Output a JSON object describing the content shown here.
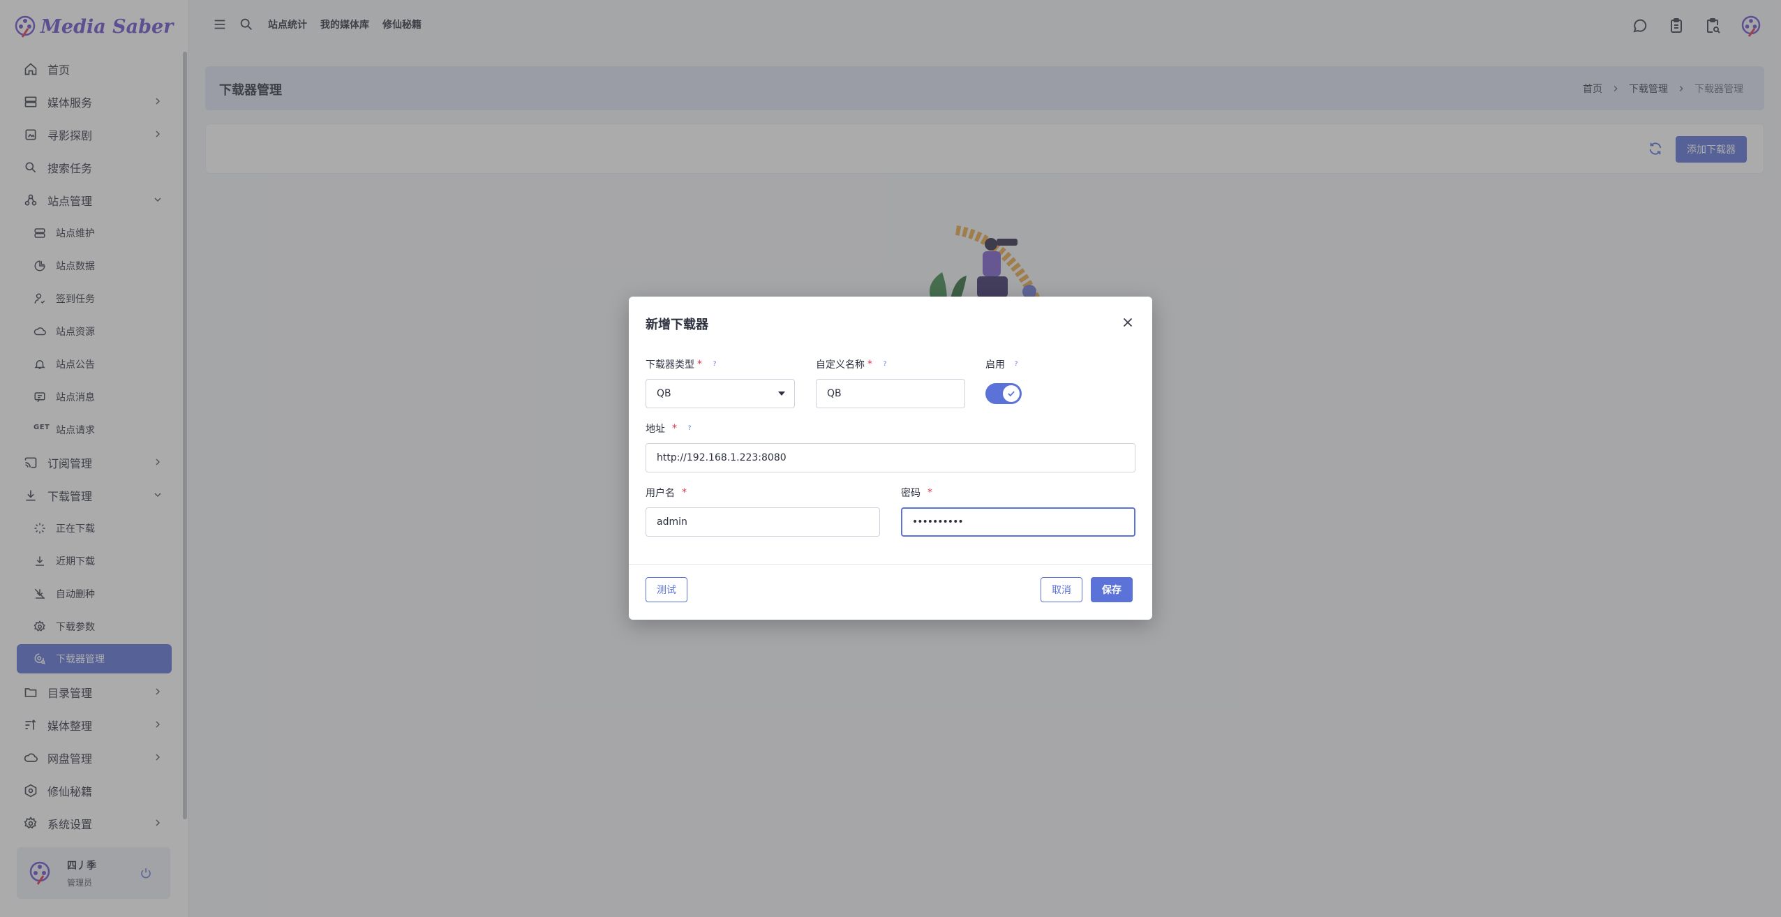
{
  "app": {
    "logo_text": "Media Saber"
  },
  "sidebar": {
    "items": [
      {
        "label": "首页",
        "icon": "home-icon"
      },
      {
        "label": "媒体服务",
        "icon": "server-icon"
      },
      {
        "label": "寻影探剧",
        "icon": "image-search-icon"
      },
      {
        "label": "搜索任务",
        "icon": "search-icon"
      },
      {
        "label": "站点管理",
        "icon": "sitemap-icon"
      },
      {
        "label": "站点维护",
        "icon": "database-icon"
      },
      {
        "label": "站点数据",
        "icon": "pie-chart-icon"
      },
      {
        "label": "签到任务",
        "icon": "user-check-icon"
      },
      {
        "label": "站点资源",
        "icon": "cloud-icon"
      },
      {
        "label": "站点公告",
        "icon": "bell-icon"
      },
      {
        "label": "站点消息",
        "icon": "message-icon"
      },
      {
        "label": "站点请求",
        "icon": "get-badge-icon",
        "badge": "GET"
      },
      {
        "label": "订阅管理",
        "icon": "cast-icon"
      },
      {
        "label": "下载管理",
        "icon": "download-icon"
      },
      {
        "label": "正在下载",
        "icon": "loader-icon"
      },
      {
        "label": "近期下载",
        "icon": "download-icon"
      },
      {
        "label": "自动删种",
        "icon": "download-off-icon"
      },
      {
        "label": "下载参数",
        "icon": "gear-icon"
      },
      {
        "label": "下载器管理",
        "icon": "gear-search-icon"
      },
      {
        "label": "目录管理",
        "icon": "folder-icon"
      },
      {
        "label": "媒体整理",
        "icon": "sort-icon"
      },
      {
        "label": "网盘管理",
        "icon": "cloud-icon"
      },
      {
        "label": "修仙秘籍",
        "icon": "settings-hex-icon"
      },
      {
        "label": "系统设置",
        "icon": "gear-icon"
      }
    ],
    "user": {
      "name": "四丿季",
      "role": "管理员"
    }
  },
  "topbar": {
    "links": [
      "站点统计",
      "我的媒体库",
      "修仙秘籍"
    ]
  },
  "page": {
    "title": "下载器管理",
    "breadcrumb": [
      "首页",
      "下载管理",
      "下载器管理"
    ],
    "add_button": "添加下载器"
  },
  "dialog": {
    "title": "新增下载器",
    "fields": {
      "type": {
        "label": "下载器类型",
        "value": "QB"
      },
      "name": {
        "label": "自定义名称",
        "value": "QB"
      },
      "enabled": {
        "label": "启用",
        "value": true
      },
      "address": {
        "label": "地址",
        "value": "http://192.168.1.223:8080"
      },
      "username": {
        "label": "用户名",
        "value": "admin"
      },
      "password": {
        "label": "密码",
        "value": "••••••••••"
      }
    },
    "required_mark": "*",
    "help_mark": "?",
    "buttons": {
      "test": "测试",
      "cancel": "取消",
      "save": "保存"
    }
  },
  "colors": {
    "accent": "#5b72d8",
    "required": "#e0364b",
    "header_bg": "#dee3f5"
  }
}
